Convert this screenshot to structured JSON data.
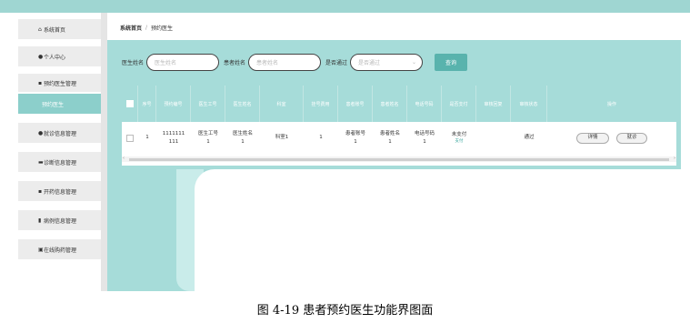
{
  "app": {
    "topbar_title": ""
  },
  "sidebar": {
    "items": [
      {
        "label": "系统首页",
        "icon": "home-icon"
      },
      {
        "label": "个人中心",
        "icon": "user-icon"
      },
      {
        "label": "预约医生管理",
        "icon": "grid-icon"
      },
      {
        "label": "预约医生",
        "icon": ""
      },
      {
        "label": "就诊信息管理",
        "icon": "pin-icon"
      },
      {
        "label": "诊断信息管理",
        "icon": "building-icon"
      },
      {
        "label": "开药信息管理",
        "icon": "grid-icon"
      },
      {
        "label": "病例信息管理",
        "icon": "document-icon"
      },
      {
        "label": "在线购药管理",
        "icon": "clipboard-icon"
      }
    ]
  },
  "breadcrumb": {
    "home": "系统首页",
    "separator": "/",
    "current": "预约医生"
  },
  "search": {
    "doctor_name_label": "医生姓名",
    "doctor_name_placeholder": "医生姓名",
    "patient_name_label": "患者姓名",
    "patient_name_placeholder": "患者姓名",
    "approved_label": "是否通过",
    "approved_placeholder": "是否通过",
    "query_button": "查询"
  },
  "table": {
    "headers": [
      "序号",
      "预约编号",
      "医生工号",
      "医生姓名",
      "科室",
      "挂号费用",
      "患者账号",
      "患者姓名",
      "电话号码",
      "是否支付",
      "审核回复",
      "审核状态",
      "操作"
    ],
    "rows": [
      {
        "index": "1",
        "booking_no": "1111111 111",
        "doctor_id": "医生工号 1",
        "doctor_name": "医生姓名 1",
        "department": "科室1",
        "fee": "1",
        "patient_account": "患者账号 1",
        "patient_name": "患者姓名 1",
        "phone": "电话号码 1",
        "paid": "未支付",
        "paid_action": "支付",
        "reply": "",
        "status": "通过",
        "action_detail": "详情",
        "action_visit": "就诊"
      }
    ]
  },
  "caption": "图 4-19 患者预约医生功能界图面",
  "colors": {
    "teal": "#a6dcd9",
    "button": "#59b3ad",
    "sidebar_active": "#8ccfcb"
  }
}
